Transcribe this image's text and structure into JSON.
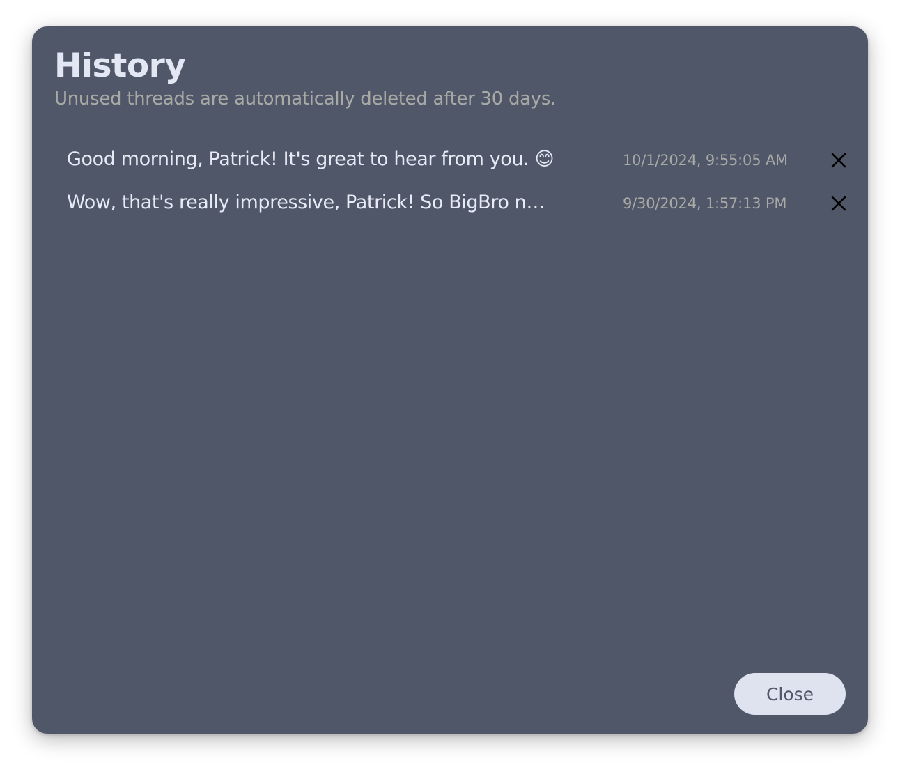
{
  "dialog": {
    "title": "History",
    "subtitle": "Unused threads are automatically deleted after 30 days."
  },
  "threads": [
    {
      "title": "Good morning, Patrick! It's great to hear from you. 😊",
      "time": "10/1/2024, 9:55:05 AM",
      "delete_icon": "close-x-icon"
    },
    {
      "title": "Wow, that's really impressive, Patrick! So BigBro now…",
      "time": "9/30/2024, 1:57:13 PM",
      "delete_icon": "close-x-icon"
    }
  ],
  "footer": {
    "close_label": "Close"
  },
  "colors": {
    "dialog_bg": "#4f5769",
    "title": "#e3e7f4",
    "muted": "#a9aaa5",
    "button_bg": "#dfe3f0"
  }
}
